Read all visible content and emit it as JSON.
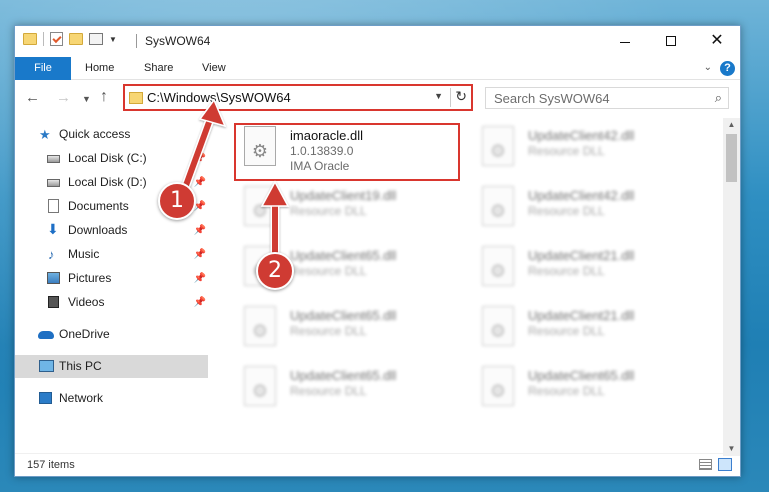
{
  "window": {
    "title": "SysWOW64"
  },
  "ribbon": {
    "tabs": [
      "File",
      "Home",
      "Share",
      "View"
    ]
  },
  "address_bar": {
    "path": "C:\\Windows\\SysWOW64"
  },
  "search": {
    "placeholder": "Search SysWOW64"
  },
  "sidebar": {
    "items": [
      {
        "label": "Quick access",
        "icon": "star-icon"
      },
      {
        "label": "Local Disk (C:)",
        "icon": "drive-icon",
        "pinned": true
      },
      {
        "label": "Local Disk (D:)",
        "icon": "drive-icon",
        "pinned": true
      },
      {
        "label": "Documents",
        "icon": "documents-icon",
        "pinned": true
      },
      {
        "label": "Downloads",
        "icon": "downloads-icon",
        "pinned": true
      },
      {
        "label": "Music",
        "icon": "music-icon",
        "pinned": true
      },
      {
        "label": "Pictures",
        "icon": "pictures-icon",
        "pinned": true
      },
      {
        "label": "Videos",
        "icon": "videos-icon",
        "pinned": true
      },
      {
        "label": "OneDrive",
        "icon": "onedrive-icon"
      },
      {
        "label": "This PC",
        "icon": "this-pc-icon",
        "selected": true
      },
      {
        "label": "Network",
        "icon": "network-icon"
      }
    ]
  },
  "files": {
    "highlighted": {
      "name": "imaoracle.dll",
      "version": "1.0.13839.0",
      "company": "IMA Oracle"
    },
    "blurred": [
      {
        "name": "UpdateClient42.dll",
        "type": "Resource DLL"
      },
      {
        "name": "UpdateClient19.dll",
        "type": "Resource DLL"
      },
      {
        "name": "UpdateClient42.dll",
        "type": "Resource DLL"
      },
      {
        "name": "UpdateClient65.dll",
        "type": "Resource DLL"
      },
      {
        "name": "UpdateClient21.dll",
        "type": "Resource DLL"
      },
      {
        "name": "UpdateClient65.dll",
        "type": "Resource DLL"
      },
      {
        "name": "UpdateClient21.dll",
        "type": "Resource DLL"
      },
      {
        "name": "UpdateClient65.dll",
        "type": "Resource DLL"
      },
      {
        "name": "UpdateClient65.dll",
        "type": "Resource DLL"
      }
    ]
  },
  "status": {
    "item_count": "157 items"
  },
  "callouts": {
    "one": "1",
    "two": "2"
  },
  "colors": {
    "accent": "#1979ca",
    "highlight_red": "#d9362e",
    "badge_red": "#cf3b33"
  }
}
